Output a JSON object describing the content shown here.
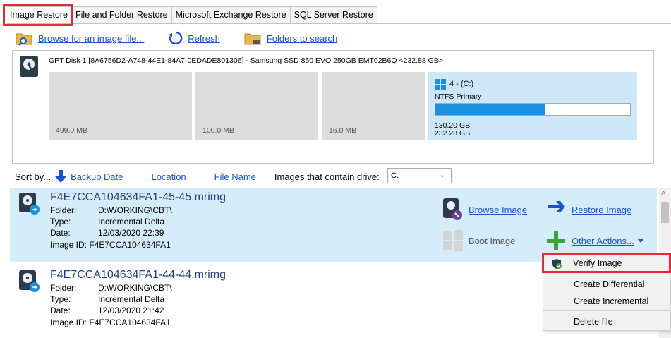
{
  "tabs": [
    {
      "label": "Image Restore",
      "active": true
    },
    {
      "label": "File and Folder Restore",
      "active": false
    },
    {
      "label": "Microsoft Exchange Restore",
      "active": false
    },
    {
      "label": "SQL Server Restore",
      "active": false
    }
  ],
  "toolbar": {
    "browse_label": "Browse for an image file...",
    "refresh_label": "Refresh",
    "folders_label": "Folders to search"
  },
  "disk": {
    "title": "GPT Disk 1 [8A6756D2-A748-44E1-84A7-0EDADE801306] - Samsung SSD 850 EVO 250GB EMT02B6Q  <232.88 GB>",
    "partitions": [
      {
        "size": "499.0 MB"
      },
      {
        "size": "100.0 MB"
      },
      {
        "size": "16.0 MB"
      }
    ],
    "selected_partition": {
      "name": "4 - (C:)",
      "type": "NTFS Primary",
      "used": "130.20 GB",
      "total": "232.28 GB",
      "used_fraction": 0.56
    }
  },
  "sort": {
    "label": "Sort by...",
    "backup_date": "Backup Date",
    "location": "Location",
    "file_name": "File Name",
    "drive_filter_label": "Images that contain drive:",
    "drive_value": "C:"
  },
  "images": [
    {
      "filename": "F4E7CCA104634FA1-45-45.mrimg",
      "folder_label": "Folder:",
      "folder": "D:\\WORKING\\CBT\\",
      "type_label": "Type:",
      "type": "Incremental Delta",
      "date_label": "Date:",
      "date": "12/03/2020 22:39",
      "id_label": "Image ID:",
      "id": "F4E7CCA104634FA1"
    },
    {
      "filename": "F4E7CCA104634FA1-44-44.mrimg",
      "folder_label": "Folder:",
      "folder": "D:\\WORKING\\CBT\\",
      "type_label": "Type:",
      "type": "Incremental Delta",
      "date_label": "Date:",
      "date": "12/03/2020 21:42",
      "id_label": "Image ID:",
      "id": "F4E7CCA104634FA1"
    }
  ],
  "actions": {
    "browse_image": "Browse Image",
    "restore_image": "Restore Image",
    "boot_image": "Boot Image",
    "other_actions": "Other Actions..."
  },
  "context_menu": {
    "verify": "Verify Image",
    "create_differential": "Create Differential",
    "create_incremental": "Create Incremental",
    "delete_file": "Delete file"
  },
  "colors": {
    "accent": "#1a55c8",
    "highlight": "#e32b34",
    "selection": "#d5ecfb",
    "partition_bar": "#1a8fe0"
  }
}
